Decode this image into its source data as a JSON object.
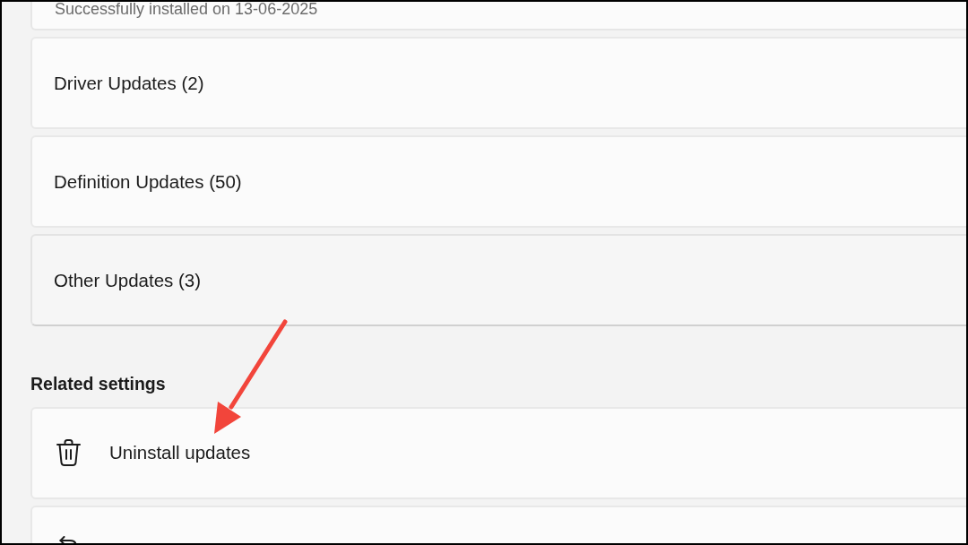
{
  "update_history": {
    "partial_item": {
      "status": "Successfully installed on 13-06-2025"
    },
    "categories": [
      {
        "label": "Driver Updates (2)",
        "hovered": false
      },
      {
        "label": "Definition Updates (50)",
        "hovered": false
      },
      {
        "label": "Other Updates (3)",
        "hovered": true
      }
    ]
  },
  "related_settings": {
    "heading": "Related settings",
    "items": [
      {
        "kind": "uninstall",
        "label": "Uninstall updates"
      },
      {
        "kind": "undo"
      }
    ]
  }
}
